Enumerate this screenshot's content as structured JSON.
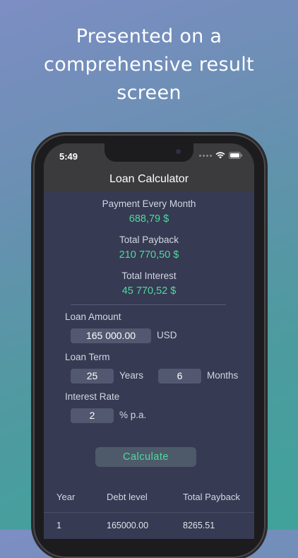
{
  "headline": {
    "line1": "Presented on a",
    "line2": "comprehensive result",
    "line3": "screen"
  },
  "status_bar": {
    "time": "5:49"
  },
  "nav": {
    "title": "Loan Calculator"
  },
  "results": {
    "payment_label": "Payment Every Month",
    "payment_value": "688,79 $",
    "payback_label": "Total Payback",
    "payback_value": "210 770,50 $",
    "interest_label": "Total Interest",
    "interest_value": "45 770,52 $"
  },
  "form": {
    "loan_amount_label": "Loan Amount",
    "loan_amount_value": "165 000.00",
    "currency": "USD",
    "loan_term_label": "Loan Term",
    "years_value": "25",
    "years_unit": "Years",
    "months_value": "6",
    "months_unit": "Months",
    "interest_rate_label": "Interest Rate",
    "interest_rate_value": "2",
    "interest_rate_unit": "% p.a.",
    "calculate_label": "Calculate"
  },
  "table": {
    "headers": [
      "Year",
      "Debt level",
      "Total Payback"
    ],
    "rows": [
      [
        "1",
        "165000.00",
        "8265.51"
      ]
    ]
  },
  "colors": {
    "accent_green": "#4fdaa0",
    "screen_bg": "#363a52",
    "bar_bg": "#3b3b3d"
  }
}
